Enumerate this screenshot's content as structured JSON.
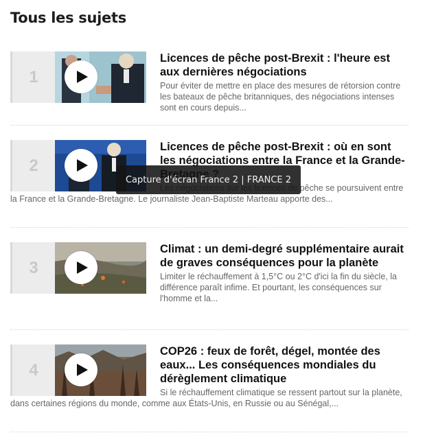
{
  "section": {
    "title": "Tous les sujets"
  },
  "items": [
    {
      "number": "1",
      "title": "Licences de pêche post-Brexit : l'heure est aux dernières négociations",
      "description": "Pour éviter de mettre en place des mesures de rétorsion contre les bateaux de pêche britanniques, des négociations intenses sont en cours depuis..."
    },
    {
      "number": "2",
      "title": "Licences de pêche post-Brexit : où en sont les négociations entre la France et la Grande-Bretagne ?",
      "description": "Les négociations sur les licences de pêche se poursuivent entre la France et la Grande-Bretagne. Le journaliste Jean-Baptiste Marteau apporte des..."
    },
    {
      "number": "3",
      "title": "Climat : un demi-degré supplémentaire aurait de graves conséquences pour la planète",
      "description": "Limiter le réchauffement à 1,5°C ou 2°C d'ici la fin du siècle, la différence paraît infime. Et pourtant, les conséquences sur l'homme et la..."
    },
    {
      "number": "4",
      "title": "COP26 : feux de forêt, dégel, montée des eaux... Les conséquences mondiales du dérèglement climatique",
      "description": "Si le réchauffement climatique se ressent partout sur la planète, dans certaines régions du monde, comme aux États-Unis, en Russie ou au Sénégal,..."
    }
  ],
  "tooltip": {
    "text": "Capture d'écran France 2 | FRANCE 2"
  },
  "icons": {
    "play": "play-icon"
  }
}
